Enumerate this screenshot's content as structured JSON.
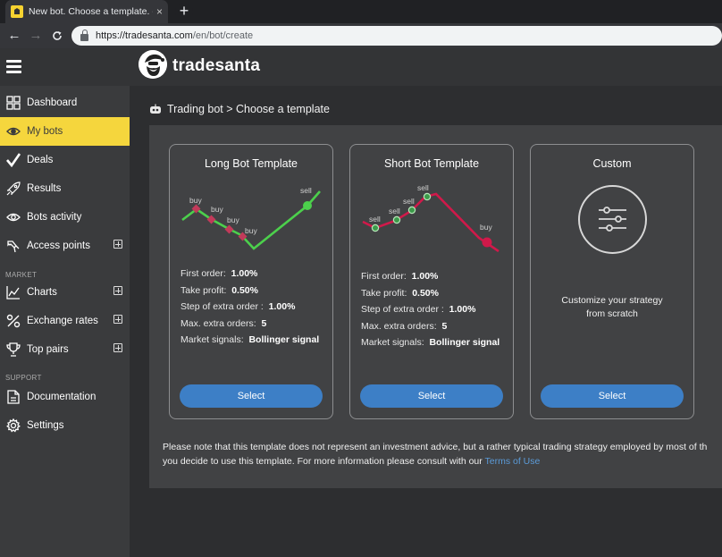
{
  "browser": {
    "tab_title": "New bot. Choose a template. - Tr",
    "tab_close": "×",
    "new_tab": "+",
    "url_scheme_host": "https://tradesanta.com",
    "url_path": "/en/bot/create"
  },
  "header": {
    "brand": "tradesanta"
  },
  "sidebar": {
    "items": [
      {
        "label": "Dashboard",
        "icon": "grid-icon"
      },
      {
        "label": "My bots",
        "icon": "eye-icon",
        "active": true
      },
      {
        "label": "Deals",
        "icon": "check-icon"
      },
      {
        "label": "Results",
        "icon": "rocket-icon"
      },
      {
        "label": "Bots activity",
        "icon": "eye-icon"
      },
      {
        "label": "Access points",
        "icon": "key-icon",
        "expandable": true
      }
    ],
    "market_section": "MARKET",
    "market_items": [
      {
        "label": "Charts",
        "icon": "chart-icon",
        "expandable": true
      },
      {
        "label": "Exchange rates",
        "icon": "percent-icon",
        "expandable": true
      },
      {
        "label": "Top pairs",
        "icon": "trophy-icon",
        "expandable": true
      }
    ],
    "support_section": "SUPPORT",
    "support_items": [
      {
        "label": "Documentation",
        "icon": "document-icon"
      },
      {
        "label": "Settings",
        "icon": "gear-icon"
      }
    ]
  },
  "main": {
    "breadcrumb": "Trading bot > Choose a template",
    "cards": [
      {
        "title": "Long Bot Template",
        "chart_labels": [
          "buy",
          "buy",
          "buy",
          "buy",
          "sell"
        ],
        "params": [
          {
            "label": "First order:",
            "value": "1.00%"
          },
          {
            "label": "Take profit:",
            "value": "0.50%"
          },
          {
            "label": "Step of extra order :",
            "value": "1.00%"
          },
          {
            "label": "Max. extra orders:",
            "value": "5"
          },
          {
            "label": "Market signals:",
            "value": "Bollinger signal"
          }
        ],
        "button": "Select"
      },
      {
        "title": "Short Bot Template",
        "chart_labels": [
          "sell",
          "sell",
          "sell",
          "sell",
          "buy"
        ],
        "params": [
          {
            "label": "First order:",
            "value": "1.00%"
          },
          {
            "label": "Take profit:",
            "value": "0.50%"
          },
          {
            "label": "Step of extra order :",
            "value": "1.00%"
          },
          {
            "label": "Max. extra orders:",
            "value": "5"
          },
          {
            "label": "Market signals:",
            "value": "Bollinger signal"
          }
        ],
        "button": "Select"
      },
      {
        "title": "Custom",
        "description_line1": "Customize your strategy",
        "description_line2": "from scratch",
        "button": "Select"
      }
    ],
    "note_line1": "Please note that this template does not represent an investment advice, but a rather typical trading strategy employed by most of th",
    "note_line2": "you decide to use this template. For more information please consult with our ",
    "note_link": "Terms of Use"
  },
  "colors": {
    "accent": "#f5d63d",
    "button": "#3d7fc6",
    "long_line": "#4cd04c",
    "short_line": "#d0194a"
  }
}
